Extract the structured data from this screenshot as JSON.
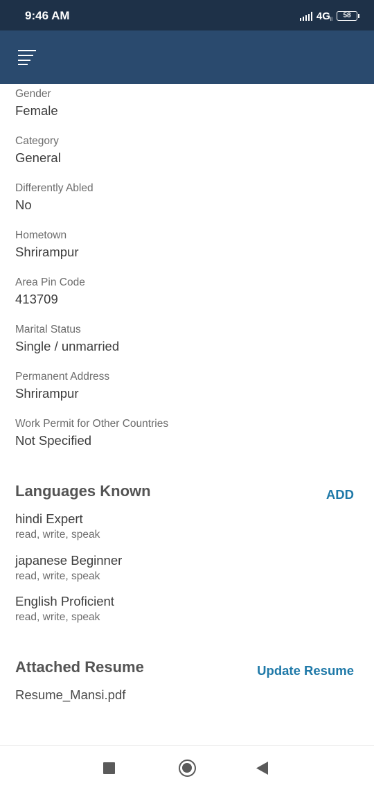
{
  "status_bar": {
    "time": "9:46 AM",
    "network": "4G",
    "battery": "58"
  },
  "app_bar": {
    "menu_icon": "hamburger-menu-icon"
  },
  "profile_fields": [
    {
      "label": "Gender",
      "value": "Female"
    },
    {
      "label": "Category",
      "value": "General"
    },
    {
      "label": "Differently Abled",
      "value": "No"
    },
    {
      "label": "Hometown",
      "value": "Shrirampur"
    },
    {
      "label": "Area Pin Code",
      "value": "413709"
    },
    {
      "label": "Marital Status",
      "value": "Single / unmarried"
    },
    {
      "label": "Permanent Address",
      "value": "Shrirampur"
    },
    {
      "label": "Work Permit for Other Countries",
      "value": "Not Specified"
    }
  ],
  "languages": {
    "title": "Languages Known",
    "add_label": "ADD",
    "items": [
      {
        "name": "hindi Expert",
        "skills": "read, write, speak"
      },
      {
        "name": "japanese Beginner",
        "skills": "read, write, speak"
      },
      {
        "name": "English Proficient",
        "skills": "read, write, speak"
      }
    ]
  },
  "resume": {
    "title": "Attached Resume",
    "update_label": "Update Resume",
    "file_name": "Resume_Mansi.pdf"
  },
  "nav_bar": {
    "recents_icon": "square-recents-icon",
    "home_icon": "circle-home-icon",
    "back_icon": "triangle-back-icon"
  },
  "colors": {
    "status_bar": "#1e3148",
    "app_bar": "#2a4a6e",
    "link": "#1f79a8"
  }
}
